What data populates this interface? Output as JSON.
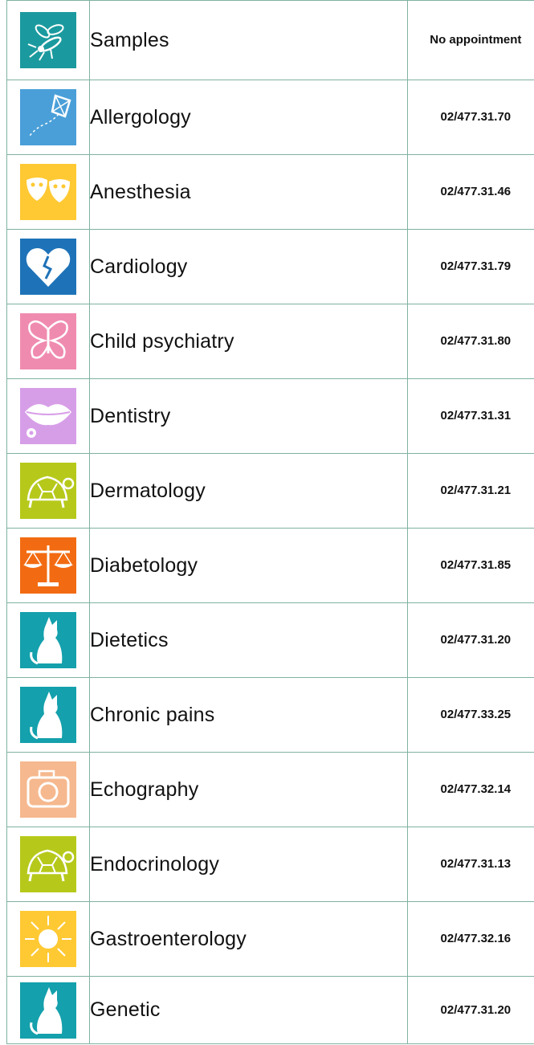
{
  "rows": [
    {
      "name": "Samples",
      "phone": "No appointment",
      "icon": "mosquito-icon",
      "color": "#1a9a9e"
    },
    {
      "name": "Allergology",
      "phone": "02/477.31.70",
      "icon": "kite-icon",
      "color": "#4a9fd8"
    },
    {
      "name": "Anesthesia",
      "phone": "02/477.31.46",
      "icon": "theater-masks-icon",
      "color": "#ffc933"
    },
    {
      "name": "Cardiology",
      "phone": "02/477.31.79",
      "icon": "broken-heart-icon",
      "color": "#1e73b8"
    },
    {
      "name": "Child psychiatry",
      "phone": "02/477.31.80",
      "icon": "butterfly-icon",
      "color": "#f08bb0"
    },
    {
      "name": "Dentistry",
      "phone": "02/477.31.31",
      "icon": "lips-icon",
      "color": "#d79ee8"
    },
    {
      "name": "Dermatology",
      "phone": "02/477.31.21",
      "icon": "turtle-icon",
      "color": "#b6c91b"
    },
    {
      "name": "Diabetology",
      "phone": "02/477.31.85",
      "icon": "scale-icon",
      "color": "#f26b12"
    },
    {
      "name": "Dietetics",
      "phone": "02/477.31.20",
      "icon": "cat-icon",
      "color": "#14a0ac"
    },
    {
      "name": "Chronic pains",
      "phone": "02/477.33.25",
      "icon": "cat-icon",
      "color": "#14a0ac"
    },
    {
      "name": "Echography",
      "phone": "02/477.32.14",
      "icon": "camera-icon",
      "color": "#f6b88e"
    },
    {
      "name": "Endocrinology",
      "phone": "02/477.31.13",
      "icon": "turtle-icon",
      "color": "#b6c91b"
    },
    {
      "name": "Gastroenterology",
      "phone": "02/477.32.16",
      "icon": "sun-icon",
      "color": "#ffc933"
    },
    {
      "name": "Genetic",
      "phone": "02/477.31.20",
      "icon": "cat-icon",
      "color": "#14a0ac"
    }
  ]
}
